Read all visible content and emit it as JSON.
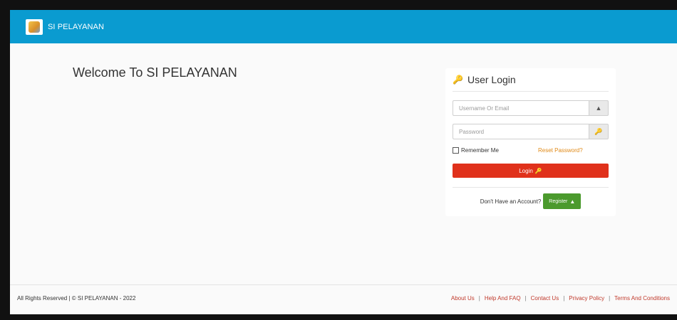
{
  "header": {
    "brand_text": "SI PELAYANAN"
  },
  "main": {
    "welcome_text": "Welcome To SI PELAYANAN"
  },
  "login": {
    "title": "User Login",
    "username_placeholder": "Username Or Email",
    "password_placeholder": "Password",
    "remember_label": "Remember Me",
    "reset_label": "Reset Password?",
    "login_button_label": "Login",
    "no_account_text": "Don't Have an Account?",
    "register_button_label": "Register"
  },
  "icons": {
    "title_icon": "key-icon",
    "username_icon": "user-icon",
    "password_icon": "key-icon",
    "login_icon": "key-icon",
    "register_icon": "user-icon"
  },
  "colors": {
    "navbar": "#0a9bd0",
    "login_button": "#e0311b",
    "register_button": "#4b9a2d",
    "reset_link": "#e08a18",
    "footer_link": "#c0392b"
  },
  "footer": {
    "copyright": "All Rights Reserved | © SI PELAYANAN - 2022",
    "links": [
      "About Us",
      "Help And FAQ",
      "Contact Us",
      "Privacy Policy",
      "Terms And Conditions"
    ]
  }
}
